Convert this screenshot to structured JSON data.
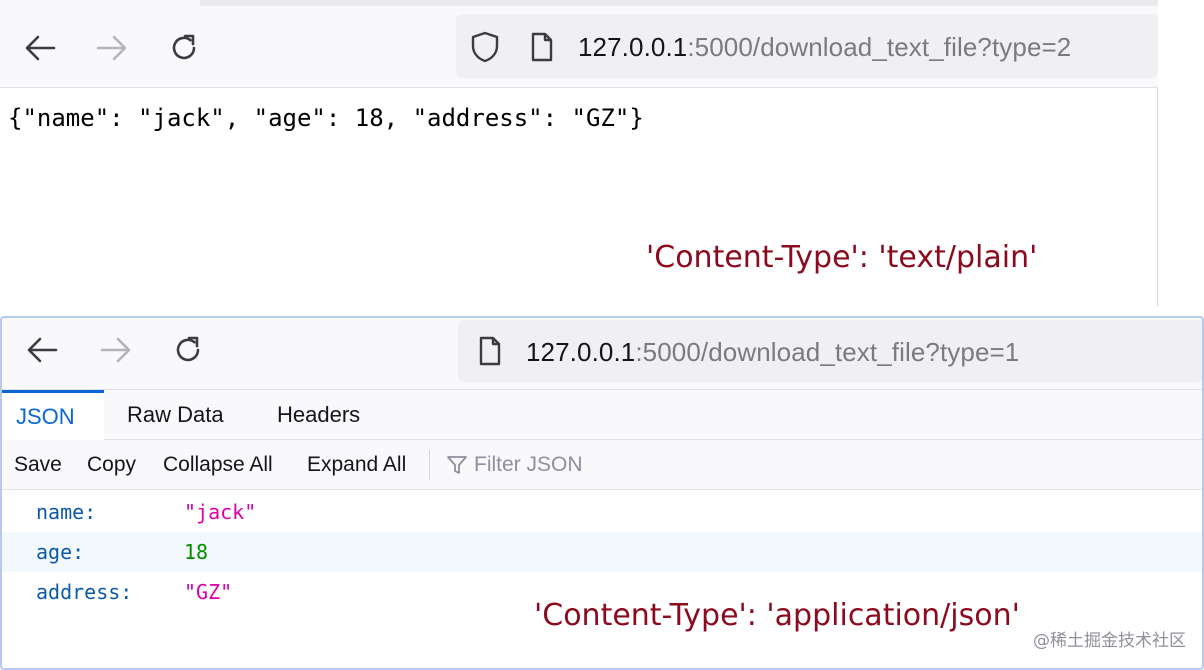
{
  "window_top": {
    "url_host": "127.0.0.1",
    "url_rest": ":5000/download_text_file?type=2",
    "body_text": "{\"name\": \"jack\", \"age\": 18, \"address\": \"GZ\"}",
    "annotation": "'Content-Type': 'text/plain'",
    "icons": [
      "back-arrow-icon",
      "forward-arrow-icon",
      "reload-icon",
      "shield-icon",
      "page-icon"
    ]
  },
  "window_bottom": {
    "url_host": "127.0.0.1",
    "url_rest": ":5000/download_text_file?type=1",
    "tabs": [
      {
        "label": "JSON",
        "selected": true
      },
      {
        "label": "Raw Data",
        "selected": false
      },
      {
        "label": "Headers",
        "selected": false
      }
    ],
    "actions": [
      "Save",
      "Copy",
      "Collapse All",
      "Expand All"
    ],
    "filter_placeholder": "Filter JSON",
    "rows": [
      {
        "key": "name:",
        "value": "\"jack\"",
        "type": "string"
      },
      {
        "key": "age:",
        "value": "18",
        "type": "number"
      },
      {
        "key": "address:",
        "value": "\"GZ\"",
        "type": "string"
      }
    ],
    "annotation": "'Content-Type': 'application/json'",
    "icons": [
      "back-arrow-icon",
      "forward-arrow-icon",
      "reload-icon",
      "page-icon",
      "filter-icon"
    ]
  },
  "watermark": "@稀土掘金技术社区",
  "colors": {
    "annotation": "#8b0a1e",
    "selected_tab": "#0a66d6",
    "json_key": "#0b5aa7",
    "json_string": "#dd00a9",
    "json_number": "#058b00"
  }
}
